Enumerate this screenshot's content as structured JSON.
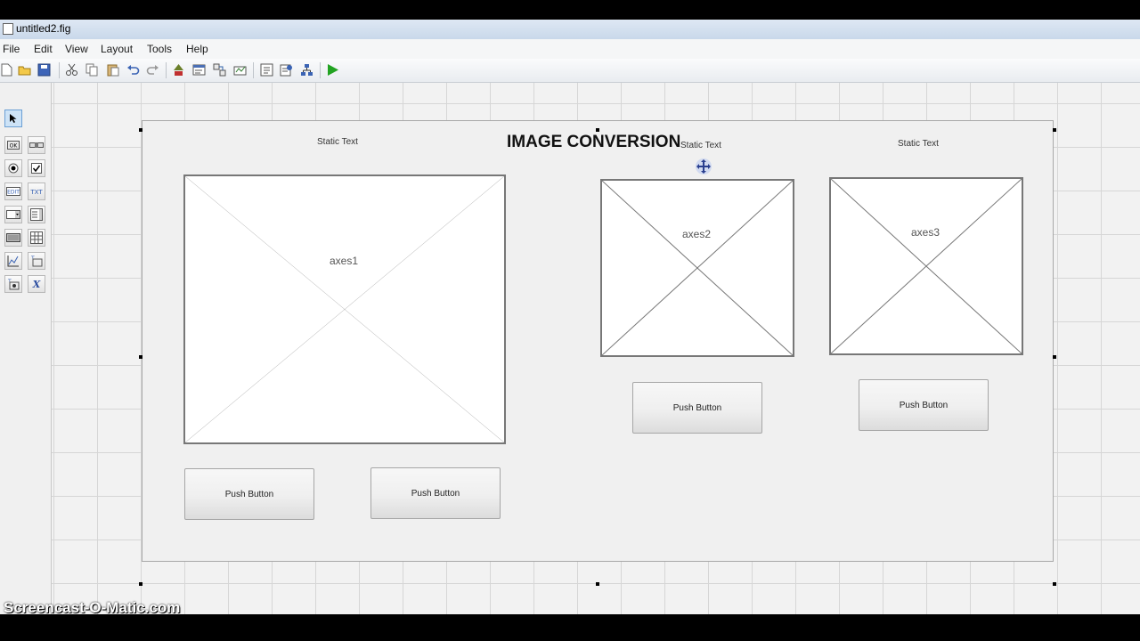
{
  "window": {
    "title": "untitled2.fig"
  },
  "menu": [
    "File",
    "Edit",
    "View",
    "Layout",
    "Tools",
    "Help"
  ],
  "toolbar": [
    "new-icon",
    "open-icon",
    "save-icon",
    "cut-icon",
    "copy-icon",
    "paste-icon",
    "undo-icon",
    "redo-icon",
    "align-icon",
    "menu-editor-icon",
    "tab-order-icon",
    "toolbar-editor-icon",
    "editor-icon",
    "property-inspector-icon",
    "object-browser-icon",
    "run-icon"
  ],
  "palette": [
    "select-tool",
    "push-button-tool",
    "slider-tool",
    "radio-button-tool",
    "checkbox-tool",
    "edit-text-tool",
    "static-text-tool",
    "popup-menu-tool",
    "listbox-tool",
    "toggle-button-tool",
    "table-tool",
    "axes-tool",
    "panel-tool",
    "button-group-tool",
    "activex-tool"
  ],
  "canvas": {
    "title": "IMAGE CONVERSION",
    "static_texts": [
      "Static Text",
      "Static Text",
      "Static Text"
    ],
    "axes": [
      "axes1",
      "axes2",
      "axes3"
    ],
    "buttons": [
      "Push Button",
      "Push Button",
      "Push Button",
      "Push Button"
    ]
  },
  "watermark": "Screencast-O-Matic.com",
  "colors": {
    "run_green": "#22a322",
    "selection_blue": "#6a9fd4"
  }
}
